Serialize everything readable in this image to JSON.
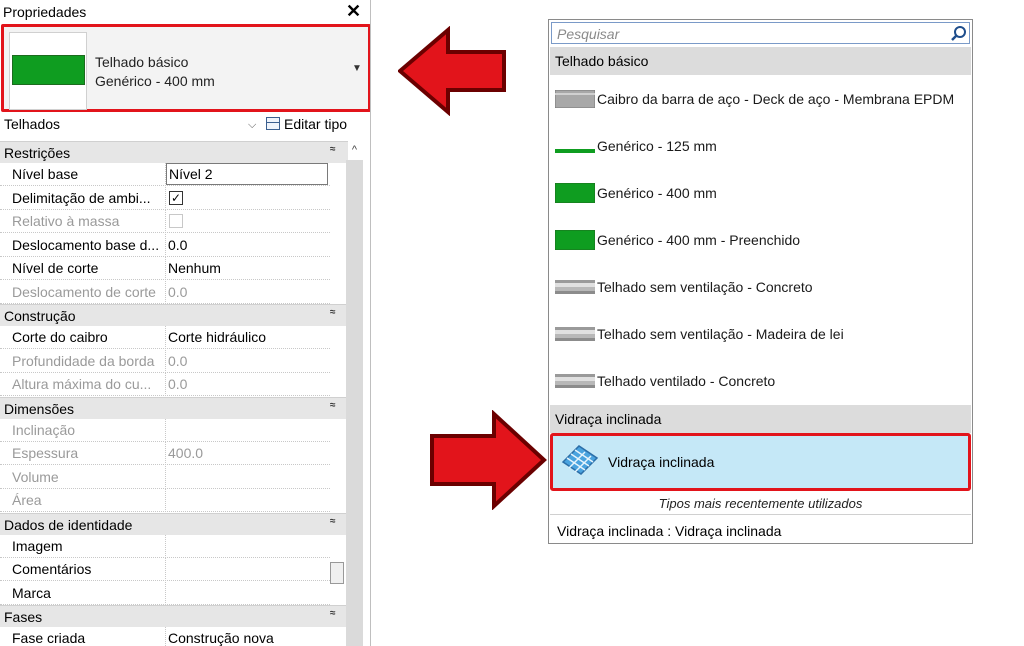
{
  "properties": {
    "title": "Propriedades",
    "close_glyph": "✕",
    "type_family": "Telhado básico",
    "type_name": "Genérico - 400 mm",
    "category": "Telhados",
    "edit_type": "Editar tipo",
    "groups": [
      {
        "label": "Restrições",
        "rows": [
          {
            "label": "Nível base",
            "value": "Nível 2",
            "dim": false
          },
          {
            "label": "Delimitação de ambi...",
            "value": "✓",
            "dim": false
          },
          {
            "label": "Relativo à massa",
            "value": "",
            "dim": true
          },
          {
            "label": "Deslocamento base d...",
            "value": "0.0",
            "dim": false
          },
          {
            "label": "Nível de corte",
            "value": "Nenhum",
            "dim": false
          },
          {
            "label": "Deslocamento de corte",
            "value": "0.0",
            "dim": true
          }
        ]
      },
      {
        "label": "Construção",
        "rows": [
          {
            "label": "Corte do caibro",
            "value": "Corte hidráulico",
            "dim": false
          },
          {
            "label": "Profundidade da borda",
            "value": "0.0",
            "dim": true
          },
          {
            "label": "Altura máxima do cu...",
            "value": "0.0",
            "dim": true
          }
        ]
      },
      {
        "label": "Dimensões",
        "rows": [
          {
            "label": "Inclinação",
            "value": "",
            "dim": true
          },
          {
            "label": "Espessura",
            "value": "400.0",
            "dim": true
          },
          {
            "label": "Volume",
            "value": "",
            "dim": true
          },
          {
            "label": "Área",
            "value": "",
            "dim": true
          }
        ]
      },
      {
        "label": "Dados de identidade",
        "rows": [
          {
            "label": "Imagem",
            "value": "",
            "dim": false
          },
          {
            "label": "Comentários",
            "value": "",
            "dim": false
          },
          {
            "label": "Marca",
            "value": "",
            "dim": false
          }
        ]
      },
      {
        "label": "Fases",
        "rows": [
          {
            "label": "Fase criada",
            "value": "Construção nova",
            "dim": false
          }
        ]
      }
    ],
    "collapse_glyph": "≈"
  },
  "dropdown": {
    "search_placeholder": "Pesquisar",
    "sections": [
      {
        "header": "Telhado básico",
        "items": [
          {
            "label": "Caibro da barra de aço - Deck de aço - Membrana EPDM",
            "swatch": "gray-thick"
          },
          {
            "label": "Genérico - 125 mm",
            "swatch": "green-thin"
          },
          {
            "label": "Genérico - 400 mm",
            "swatch": "green-thick"
          },
          {
            "label": "Genérico - 400 mm - Preenchido",
            "swatch": "green-thick"
          },
          {
            "label": "Telhado sem ventilação - Concreto",
            "swatch": "gray-layered"
          },
          {
            "label": "Telhado sem ventilação - Madeira de lei",
            "swatch": "gray-layered"
          },
          {
            "label": "Telhado ventilado - Concreto",
            "swatch": "gray-layered"
          }
        ]
      },
      {
        "header": "Vidraça inclinada",
        "items": [
          {
            "label": "Vidraça inclinada",
            "swatch": "glass-icon",
            "selected": true
          }
        ]
      }
    ],
    "recent_header": "Tipos mais recentemente utilizados",
    "recent_items": [
      "Vidraça inclinada : Vidraça inclinada"
    ]
  },
  "colors": {
    "highlight_red": "#e2141b",
    "selection_blue": "#c5e8f7",
    "swatch_green": "#0f9d20"
  }
}
